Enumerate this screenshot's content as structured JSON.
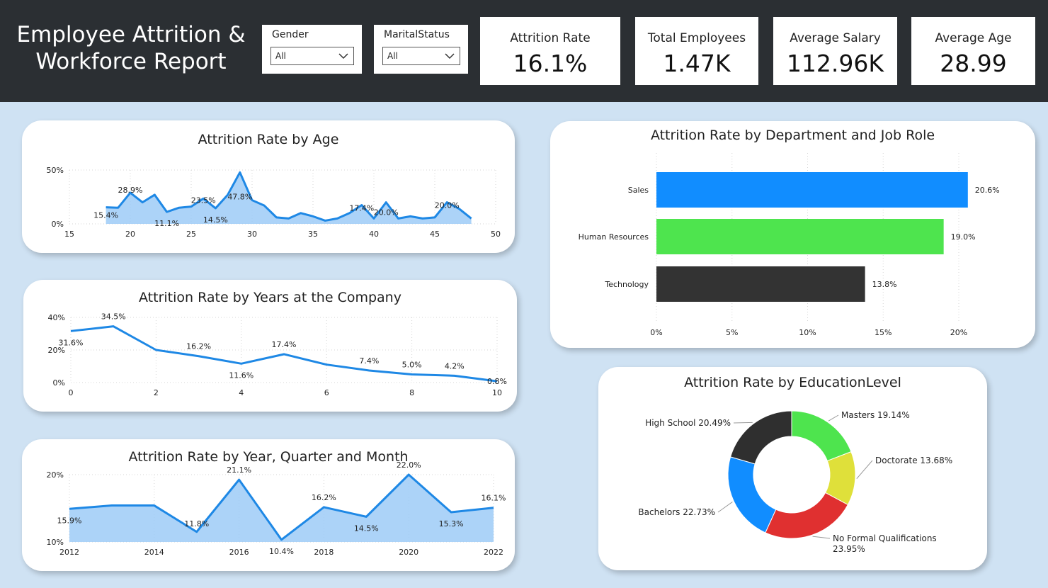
{
  "header": {
    "title": "Employee Attrition &\nWorkforce Report",
    "slicers": [
      {
        "label": "Gender",
        "value": "All"
      },
      {
        "label": "MaritalStatus",
        "value": "All"
      }
    ],
    "kpis": [
      {
        "label": "Attrition Rate",
        "value": "16.1%"
      },
      {
        "label": "Total Employees",
        "value": "1.47K"
      },
      {
        "label": "Average Salary",
        "value": "112.96K"
      },
      {
        "label": "Average Age",
        "value": "28.99"
      }
    ]
  },
  "colors": {
    "line": "#1e88e5",
    "area": "#9ecbf7",
    "sales": "#118dff",
    "hr": "#4ee44e",
    "tech": "#333333",
    "masters": "#4ee44e",
    "doctorate": "#dfe03a",
    "noformal": "#e03030",
    "bachelors": "#118dff",
    "highschool": "#2f2f2f"
  },
  "chart_data": [
    {
      "type": "area",
      "title": "Attrition Rate by Age",
      "xlim": [
        15,
        50
      ],
      "ylim": [
        0,
        50
      ],
      "x_ticks": [
        "15",
        "20",
        "25",
        "30",
        "35",
        "40",
        "45",
        "50"
      ],
      "y_ticks": [
        "0%",
        "50%"
      ],
      "x": [
        18,
        19,
        20,
        21,
        22,
        23,
        24,
        25,
        26,
        27,
        28,
        29,
        30,
        31,
        32,
        33,
        34,
        35,
        36,
        37,
        38,
        39,
        40,
        41,
        42,
        43,
        44,
        45,
        46,
        47,
        48
      ],
      "values": [
        15.4,
        15,
        28.9,
        20,
        27,
        11.1,
        15,
        16,
        23.5,
        14.5,
        27,
        47.8,
        22,
        17,
        6,
        5,
        10,
        7,
        3,
        5,
        10,
        17.4,
        5,
        20.0,
        5,
        7,
        5,
        6,
        20.0,
        14,
        5
      ],
      "labels": [
        {
          "x": 18,
          "text": "15.4%"
        },
        {
          "x": 20,
          "text": "28.9%"
        },
        {
          "x": 23,
          "text": "11.1%"
        },
        {
          "x": 26,
          "text": "23.5%"
        },
        {
          "x": 27,
          "text": "14.5%"
        },
        {
          "x": 29,
          "text": "47.8%"
        },
        {
          "x": 39,
          "text": "17.4%"
        },
        {
          "x": 41,
          "text": "20.0%"
        },
        {
          "x": 46,
          "text": "20.0%"
        }
      ]
    },
    {
      "type": "line",
      "title": "Attrition Rate by Years at the Company",
      "xlim": [
        0,
        10
      ],
      "ylim": [
        0,
        40
      ],
      "x_ticks": [
        "0",
        "2",
        "4",
        "6",
        "8",
        "10"
      ],
      "y_ticks": [
        "0%",
        "20%",
        "40%"
      ],
      "x": [
        0,
        1,
        2,
        3,
        4,
        5,
        6,
        7,
        8,
        9,
        10
      ],
      "values": [
        31.6,
        34.5,
        20.0,
        16.2,
        11.6,
        17.4,
        11.0,
        7.4,
        5.0,
        4.2,
        0.8
      ],
      "labels": [
        {
          "x": 0,
          "text": "31.6%"
        },
        {
          "x": 1,
          "text": "34.5%"
        },
        {
          "x": 3,
          "text": "16.2%"
        },
        {
          "x": 4,
          "text": "11.6%"
        },
        {
          "x": 5,
          "text": "17.4%"
        },
        {
          "x": 7,
          "text": "7.4%"
        },
        {
          "x": 8,
          "text": "5.0%"
        },
        {
          "x": 9,
          "text": "4.2%"
        },
        {
          "x": 10,
          "text": "0.8%"
        }
      ]
    },
    {
      "type": "area",
      "title": "Attrition Rate by Year, Quarter and Month",
      "xlim": [
        2012,
        2022
      ],
      "ylim": [
        10,
        22
      ],
      "x_ticks": [
        "2012",
        "2014",
        "2016",
        "2018",
        "2020",
        "2022"
      ],
      "y_ticks": [
        "10%",
        "20%"
      ],
      "x": [
        2012,
        2013,
        2014,
        2015,
        2016,
        2017,
        2018,
        2019,
        2020,
        2021,
        2022
      ],
      "values": [
        15.9,
        16.5,
        16.5,
        11.8,
        21.1,
        10.4,
        16.2,
        14.5,
        22.0,
        15.3,
        16.1
      ],
      "labels": [
        {
          "x": 2012,
          "text": "15.9%"
        },
        {
          "x": 2015,
          "text": "11.8%"
        },
        {
          "x": 2016,
          "text": "21.1%"
        },
        {
          "x": 2017,
          "text": "10.4%"
        },
        {
          "x": 2018,
          "text": "16.2%"
        },
        {
          "x": 2019,
          "text": "14.5%"
        },
        {
          "x": 2020,
          "text": "22.0%"
        },
        {
          "x": 2021,
          "text": "15.3%"
        },
        {
          "x": 2022,
          "text": "16.1%"
        }
      ]
    },
    {
      "type": "bar",
      "orientation": "horizontal",
      "title": "Attrition Rate by Department and Job Role",
      "categories": [
        "Sales",
        "Human Resources",
        "Technology"
      ],
      "values": [
        20.6,
        19.0,
        13.8
      ],
      "value_labels": [
        "20.6%",
        "19.0%",
        "13.8%"
      ],
      "xlim": [
        0,
        22
      ],
      "x_ticks": [
        0,
        5,
        10,
        15,
        20
      ],
      "x_tick_labels": [
        "0%",
        "5%",
        "10%",
        "15%",
        "20%"
      ]
    },
    {
      "type": "pie",
      "donut": true,
      "title": "Attrition Rate by EducationLevel",
      "slices": [
        {
          "label": "Masters",
          "value": 19.14,
          "text": "Masters 19.14%"
        },
        {
          "label": "Doctorate",
          "value": 13.68,
          "text": "Doctorate 13.68%"
        },
        {
          "label": "No Formal Qualifications",
          "value": 23.95,
          "text": "No Formal Qualifications\n23.95%"
        },
        {
          "label": "Bachelors",
          "value": 22.73,
          "text": "Bachelors 22.73%"
        },
        {
          "label": "High School",
          "value": 20.49,
          "text": "High School 20.49%"
        }
      ]
    }
  ]
}
